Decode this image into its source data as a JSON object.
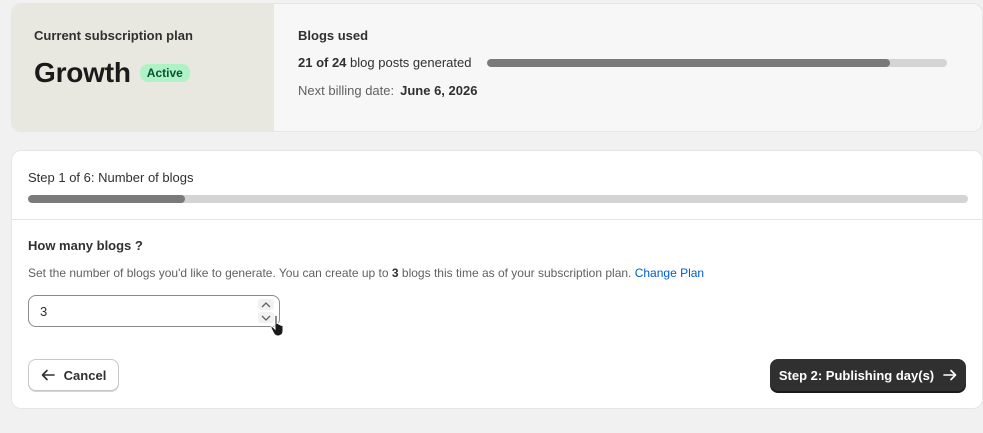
{
  "plan": {
    "label": "Current subscription plan",
    "name": "Growth",
    "status": "Active"
  },
  "usage": {
    "title": "Blogs used",
    "used_text": "21 of 24",
    "used_suffix": "blog posts generated",
    "used": 21,
    "total": 24,
    "billing_label": "Next billing date:",
    "billing_date": "June 6, 2026"
  },
  "wizard": {
    "step_label": "Step 1 of 6: Number of blogs",
    "step": 1,
    "steps_total": 6,
    "question": "How many blogs ?",
    "desc_prefix": "Set the number of blogs you'd like to generate. You can create up to",
    "desc_max": "3",
    "desc_suffix": "blogs this time as of your subscription plan.",
    "change_plan": "Change Plan",
    "input_value": "3"
  },
  "footer": {
    "cancel_label": "Cancel",
    "next_label": "Step 2: Publishing day(s)"
  },
  "icons": {
    "back": "arrow-left-icon",
    "next": "arrow-right-icon",
    "up": "chevron-up-icon",
    "down": "chevron-down-icon",
    "cursor": "hand-cursor-icon"
  }
}
